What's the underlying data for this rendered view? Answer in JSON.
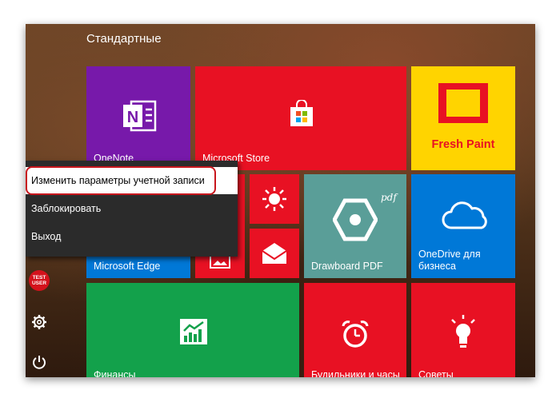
{
  "group_title": "Стандартные",
  "tiles": {
    "onenote": {
      "label": "OneNote",
      "color": "#7719aa"
    },
    "store": {
      "label": "Microsoft Store",
      "color": "#e81123"
    },
    "freshpaint": {
      "label": "Fresh Paint",
      "color": "#ffd400"
    },
    "edge": {
      "label": "Microsoft Edge",
      "color": "#0078d7"
    },
    "weather": {
      "color": "#e81123"
    },
    "mail": {
      "color": "#e81123"
    },
    "photos": {
      "color": "#e81123"
    },
    "drawboard": {
      "label": "Drawboard PDF",
      "badge": "pdf",
      "color": "#5a9e98"
    },
    "onedrive": {
      "label": "OneDrive для бизнеса",
      "color": "#0078d7"
    },
    "finance": {
      "label": "Финансы",
      "color": "#13a14b"
    },
    "alarms": {
      "label": "Будильники и часы",
      "color": "#e81123"
    },
    "tips": {
      "label": "Советы",
      "color": "#e81123"
    }
  },
  "context_menu": {
    "items": [
      "Изменить параметры учетной записи",
      "Заблокировать",
      "Выход"
    ],
    "highlight_color": "#c8161d"
  },
  "rail": {
    "avatar_text_line1": "TEST",
    "avatar_text_line2": "USER",
    "icons": [
      "settings-icon",
      "power-icon"
    ]
  }
}
